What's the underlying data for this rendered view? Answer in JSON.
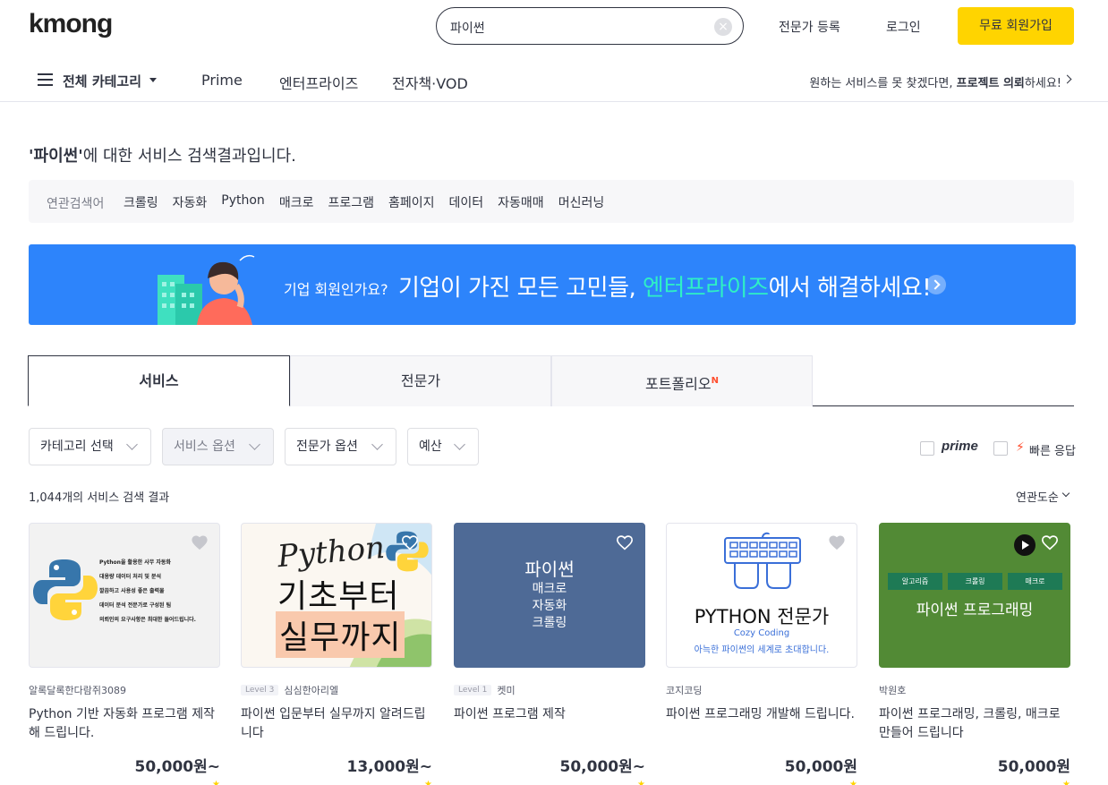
{
  "header": {
    "logo": "kmong",
    "search_value": "파이썬",
    "expert_register": "전문가 등록",
    "login": "로그인",
    "signup": "무료 회원가입"
  },
  "nav": {
    "all_category": "전체 카테고리",
    "links": [
      "Prime",
      "엔터프라이즈",
      "전자책·VOD"
    ],
    "right_prefix": "원하는 서비스를 못 찾겠다면, ",
    "right_bold": "프로젝트 의뢰",
    "right_suffix": "하세요!"
  },
  "results": {
    "query_quoted": "'파이썬'",
    "title_rest": "에 대한 서비스 검색결과입니다."
  },
  "related": {
    "label": "연관검색어",
    "keywords": [
      "크롤링",
      "자동화",
      "Python",
      "매크로",
      "프로그램",
      "홈페이지",
      "데이터",
      "자동매매",
      "머신러닝"
    ]
  },
  "banner": {
    "small": "기업 회원인가요?",
    "big_prefix": "기업이 가진 모든 고민들, ",
    "big_highlight": "엔터프라이즈",
    "big_suffix": "에서 해결하세요!"
  },
  "tabs": [
    {
      "label": "서비스",
      "badge": ""
    },
    {
      "label": "전문가",
      "badge": ""
    },
    {
      "label": "포트폴리오",
      "badge": "N"
    }
  ],
  "filters": [
    "카테고리 선택",
    "서비스 옵션",
    "전문가 옵션",
    "예산"
  ],
  "toggles": {
    "prime": "prime",
    "fast": "빠른 응답"
  },
  "count_text": "1,044개의 서비스 검색 결과",
  "sort": "연관도순",
  "colors": {
    "accent_yellow": "#ffd400",
    "banner_blue": "#2d84fb",
    "banner_highlight": "#2ef0c5",
    "badge_red": "#ff4d2d"
  },
  "cards": [
    {
      "seller": "알록달록한다람쥐3089",
      "level": "",
      "title": "Python 기반 자동화 프로그램 제작해 드립니다.",
      "price": "50,000원~",
      "thumb_lines": [
        "Python을 활용한 사무 자동화",
        "대용량 데이터 처리 및 분석",
        "깔끔하고 사용성 좋은 출력물",
        "데이터 분석 전문가로 구성된 팀",
        "의뢰인의 요구사항은 최대한 들어드립니다."
      ]
    },
    {
      "seller": "심심한아리엘",
      "level": "Level 3",
      "title": "파이썬 입문부터 실무까지 알려드립니다",
      "price": "13,000원~",
      "thumb_script": "Python",
      "thumb_line1": "기초부터",
      "thumb_line2": "실무까지"
    },
    {
      "seller": "켓미",
      "level": "Level 1",
      "title": "파이썬 프로그램 제작",
      "price": "50,000원~",
      "thumb_big": "파이썬",
      "thumb_lines": [
        "매크로",
        "자동화",
        "크롤링"
      ]
    },
    {
      "seller": "코지코딩",
      "level": "",
      "title": "파이썬 프로그래밍 개발해 드립니다.",
      "price": "50,000원",
      "thumb_big": "PYTHON 전문가",
      "thumb_sub": "Cozy Coding",
      "thumb_caption": "아늑한 파이썬의 세계로 초대합니다."
    },
    {
      "seller": "박원호",
      "level": "",
      "title": "파이썬 프로그래밍, 크롤링, 매크로 만들어 드립니다",
      "price": "50,000원",
      "thumb_tags": [
        "알고리즘",
        "크롤링",
        "매크로"
      ],
      "thumb_big": "파이썬 프로그래밍"
    }
  ]
}
